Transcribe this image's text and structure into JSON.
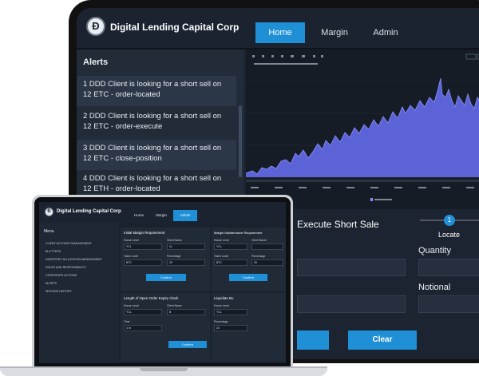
{
  "monitor": {
    "brand": "Digital Lending Capital Corp",
    "logo_letter": "Đ",
    "nav": [
      "Home",
      "Margin",
      "Admin"
    ],
    "alerts_title": "Alerts",
    "alerts": [
      "1 DDD Client is looking for a short sell on 12 ETC - order-located",
      "2 DDD Client is looking for a short sell on 12 ETC - order-execute",
      "3 DDD Client is looking for a short sell on 12 ETC - close-position",
      "4 DDD Client is looking for a short sell on 12 ETH - order-located"
    ],
    "short_sale": {
      "title": "Execute Short Sale",
      "step_number": "1",
      "step_label": "Locate",
      "quantity_label": "Quantity",
      "notional_label": "Notional",
      "clear_label": "Clear"
    }
  },
  "laptop": {
    "brand": "Digital Lending Capital Corp",
    "logo_letter": "Đ",
    "nav": [
      "Home",
      "Margin",
      "Admin"
    ],
    "menu_title": "Menu",
    "menu_items": [
      "CLIENT ACCOUNT MANAGEMENT",
      "BLOTTERS",
      "INVENTORY ALLOCATION MANAGEMENT",
      "ROLES AND RESPONSIBILITY",
      "CORPORATE ACTIONS",
      "ALERTS",
      "SESSION HISTORY"
    ],
    "panels": {
      "initial_margin": {
        "title": "Initial Margin Requirement",
        "house_label": "House Level",
        "client_label": "Client Name",
        "house_value": "YCL",
        "client_value": "11",
        "token_label": "Token Level",
        "pct_label": "Percentage",
        "token_value": "BTC",
        "pct_value": "20",
        "button": "Confirm"
      },
      "maintenance_margin": {
        "title": "Margin Maintenance Requirement",
        "house_label": "House Level",
        "client_label": "Client Name",
        "house_value": "YCL",
        "client_value": "",
        "token_label": "Token Level",
        "pct_label": "Percentage",
        "token_value": "BTC",
        "pct_value": "20",
        "button": "Confirm"
      },
      "expiry_clock": {
        "title": "Length of Open Order Expiry Clock",
        "house_label": "House Level",
        "client_label": "Client Name",
        "house_value": "YCL",
        "client_value": "B",
        "time_label": "Time",
        "time_value": "4 hr",
        "button": "Confirm"
      },
      "liquidate": {
        "title": "Liquidate Bu",
        "house_label": "House Level",
        "house_value": "YCL",
        "pct_label": "Percentage",
        "pct_value": "20"
      }
    }
  },
  "colors": {
    "accent": "#1f8fd6",
    "panel": "#222b38",
    "chart_fill": "#5b63d6"
  }
}
